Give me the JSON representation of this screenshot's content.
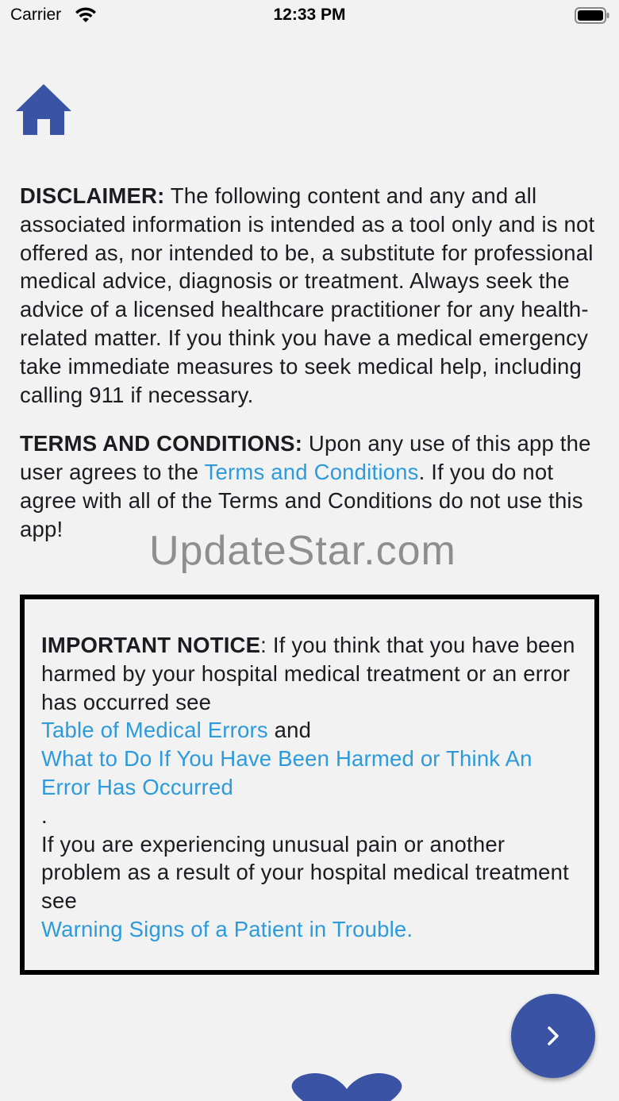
{
  "status_bar": {
    "carrier": "Carrier",
    "time": "12:33 PM"
  },
  "disclaimer": {
    "heading": "DISCLAIMER:",
    "text": " The following content and any and all associated information is intended as a tool only and is not offered as, nor intended to be, a substitute for professional medical advice, diagnosis or treatment. Always seek the advice of a licensed healthcare practitioner for any health-related matter. If you think you have a medical emergency take immediate measures to seek medical help, including calling 911 if necessary."
  },
  "terms": {
    "heading": "TERMS AND CONDITIONS:",
    "text_before": " Upon any use of this app the user agrees to the ",
    "link": "Terms and Conditions",
    "text_after": ". If you do not agree with all of the Terms and Conditions do not use this app!"
  },
  "notice": {
    "heading": "IMPORTANT NOTICE",
    "text1": ": If you think that you have been harmed by your hospital medical treatment or an error has occurred see",
    "link1": "Table of Medical Errors",
    "and": " and",
    "link2": "What to Do If You Have Been Harmed or Think An Error Has Occurred",
    "period": ".",
    "text2": "If you are experiencing unusual pain or another problem as a result of your hospital medical treatment see",
    "link3": "Warning Signs of a Patient in Trouble."
  },
  "watermark": "UpdateStar.com",
  "colors": {
    "brand_blue": "#3a53a4",
    "link_blue": "#2d9bdb"
  },
  "icons": {
    "home": "home-icon",
    "next": "chevron-right-icon",
    "heart": "heart-icon"
  }
}
